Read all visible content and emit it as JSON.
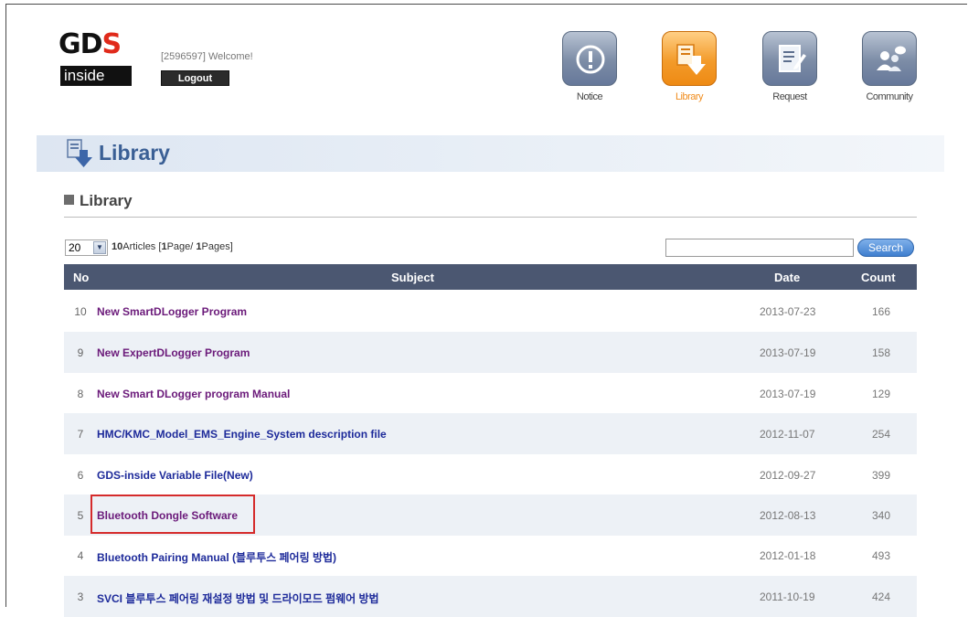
{
  "header": {
    "logo_text_1": "GD",
    "logo_text_2": "S",
    "logo_sub": "inside",
    "welcome": "[2596597] Welcome!",
    "logout_label": "Logout"
  },
  "nav": [
    {
      "label": "Notice",
      "icon": "notice-icon",
      "active": false
    },
    {
      "label": "Library",
      "icon": "library-icon",
      "active": true
    },
    {
      "label": "Request",
      "icon": "request-icon",
      "active": false
    },
    {
      "label": "Community",
      "icon": "community-icon",
      "active": false
    }
  ],
  "page": {
    "title": "Library",
    "section": "Library"
  },
  "list_controls": {
    "per_page": "20",
    "articles_count": "10",
    "articles_label": "Articles [",
    "page_current": "1",
    "page_label": "Page/ ",
    "page_total": "1",
    "pages_label": "Pages]",
    "search_value": "",
    "search_label": "Search"
  },
  "table": {
    "headers": {
      "no": "No",
      "subject": "Subject",
      "date": "Date",
      "count": "Count"
    },
    "rows": [
      {
        "no": "10",
        "subject": "New SmartDLogger Program",
        "date": "2013-07-23",
        "count": "166"
      },
      {
        "no": "9",
        "subject": "New ExpertDLogger Program",
        "date": "2013-07-19",
        "count": "158"
      },
      {
        "no": "8",
        "subject": "New Smart DLogger program Manual",
        "date": "2013-07-19",
        "count": "129"
      },
      {
        "no": "7",
        "subject": "HMC/KMC_Model_EMS_Engine_System description file",
        "date": "2012-11-07",
        "count": "254"
      },
      {
        "no": "6",
        "subject": "GDS-inside Variable File(New)",
        "date": "2012-09-27",
        "count": "399"
      },
      {
        "no": "5",
        "subject": "Bluetooth Dongle Software",
        "date": "2012-08-13",
        "count": "340"
      },
      {
        "no": "4",
        "subject": "Bluetooth Pairing Manual (블루투스 페어링 방법)",
        "date": "2012-01-18",
        "count": "493"
      },
      {
        "no": "3",
        "subject": "SVCI 블루투스 페어링 재설정 방법 및 드라이모드 펌웨어 방법",
        "date": "2011-10-19",
        "count": "424"
      }
    ]
  },
  "colors": {
    "header_bar": "#4b5771",
    "accent_orange": "#f08c1c",
    "title_blue": "#3a5f95",
    "highlight_red": "#d52b2b"
  }
}
